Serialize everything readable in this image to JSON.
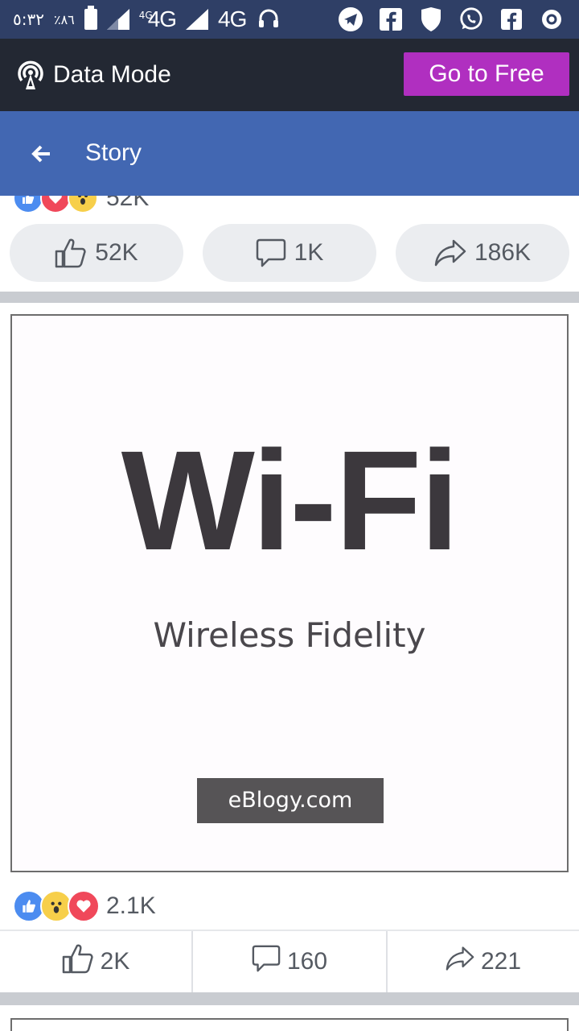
{
  "status_bar": {
    "time": "٥:٣٢",
    "battery_percent": "٪٨٦",
    "network_small": "4G",
    "network_1": "4G",
    "network_2": "4G",
    "icons": [
      "headset-icon",
      "telegram-icon",
      "facebook-icon",
      "shield-icon",
      "whatsapp-icon",
      "facebook-lite-icon",
      "circle-icon"
    ]
  },
  "data_mode_bar": {
    "title": "Data Mode",
    "go_free_label": "Go to Free",
    "accent_color": "#b02fc0"
  },
  "header": {
    "title": "Story",
    "color": "#4267b2"
  },
  "previous_post": {
    "reaction_count": "52K",
    "like_count": "52K",
    "comment_count": "1K",
    "share_count": "186K"
  },
  "post": {
    "image": {
      "title": "Wi-Fi",
      "subtitle": "Wireless Fidelity",
      "watermark": "eBlogy.com"
    },
    "reaction_count": "2.1K",
    "like_count": "2K",
    "comment_count": "160",
    "share_count": "221"
  }
}
